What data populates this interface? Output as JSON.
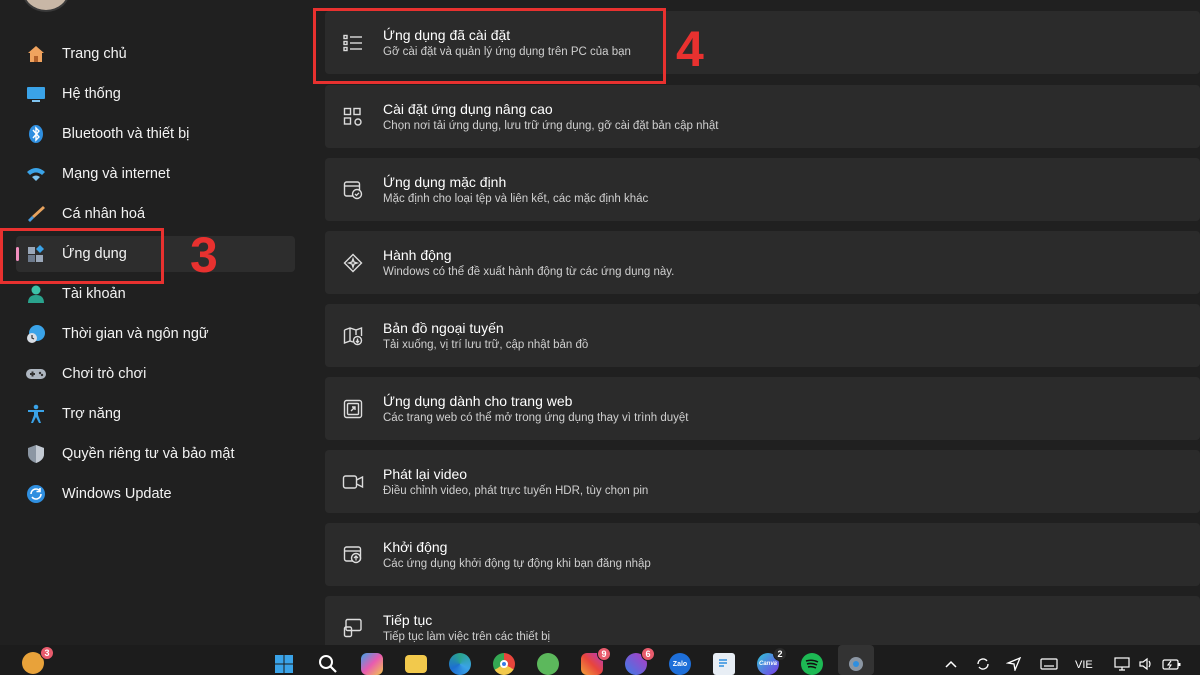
{
  "sidebar": {
    "items": [
      {
        "label": "Trang chủ",
        "icon": "home-icon",
        "active": false
      },
      {
        "label": "Hệ thống",
        "icon": "monitor-icon",
        "active": false
      },
      {
        "label": "Bluetooth và thiết bị",
        "icon": "bluetooth-icon",
        "active": false
      },
      {
        "label": "Mạng và internet",
        "icon": "wifi-icon",
        "active": false
      },
      {
        "label": "Cá nhân hoá",
        "icon": "brush-icon",
        "active": false
      },
      {
        "label": "Ứng dụng",
        "icon": "apps-icon",
        "active": true
      },
      {
        "label": "Tài khoản",
        "icon": "account-icon",
        "active": false
      },
      {
        "label": "Thời gian và ngôn ngữ",
        "icon": "globe-clock-icon",
        "active": false
      },
      {
        "label": "Chơi trò chơi",
        "icon": "gamepad-icon",
        "active": false
      },
      {
        "label": "Trợ năng",
        "icon": "accessibility-icon",
        "active": false
      },
      {
        "label": "Quyền riêng tư và bảo mật",
        "icon": "shield-icon",
        "active": false
      },
      {
        "label": "Windows Update",
        "icon": "update-icon",
        "active": false
      }
    ]
  },
  "main": {
    "cards": [
      {
        "title": "Ứng dụng đã cài đặt",
        "subtitle": "Gỡ cài đặt và quản lý ứng dụng trên PC của bạn",
        "icon": "installed-apps-list-icon"
      },
      {
        "title": "Cài đặt ứng dụng nâng cao",
        "subtitle": "Chọn nơi tải ứng dụng, lưu trữ ứng dụng, gỡ cài đặt bản cập nhật",
        "icon": "advanced-app-settings-icon"
      },
      {
        "title": "Ứng dụng mặc định",
        "subtitle": "Mặc định cho loại tệp và liên kết, các mặc định khác",
        "icon": "default-apps-icon"
      },
      {
        "title": "Hành động",
        "subtitle": "Windows có thể đề xuất hành động từ các ứng dụng này.",
        "icon": "actions-icon"
      },
      {
        "title": "Bản đồ ngoại tuyến",
        "subtitle": "Tải xuống, vị trí lưu trữ, cập nhật bản đồ",
        "icon": "offline-maps-icon"
      },
      {
        "title": "Ứng dụng dành cho trang web",
        "subtitle": "Các trang web có thể mở trong ứng dụng thay vì trình duyệt",
        "icon": "apps-for-websites-icon"
      },
      {
        "title": "Phát lại video",
        "subtitle": "Điều chỉnh video, phát trực tuyến HDR, tùy chọn pin",
        "icon": "video-camera-icon"
      },
      {
        "title": "Khởi động",
        "subtitle": "Các ứng dụng khởi động tự động khi bạn đăng nhập",
        "icon": "startup-icon"
      },
      {
        "title": "Tiếp tục",
        "subtitle": "Tiếp tục làm việc trên các thiết bị",
        "icon": "resume-icon"
      }
    ]
  },
  "annotations": {
    "step3": "3",
    "step4": "4",
    "color": "#e8312f"
  },
  "taskbar": {
    "weather_badge": "3",
    "instagram_badge": "9",
    "messenger_badge": "6",
    "zalo_label": "Zalo",
    "canva_label": "Canva",
    "canva_badge": "2",
    "language": "VIE"
  }
}
